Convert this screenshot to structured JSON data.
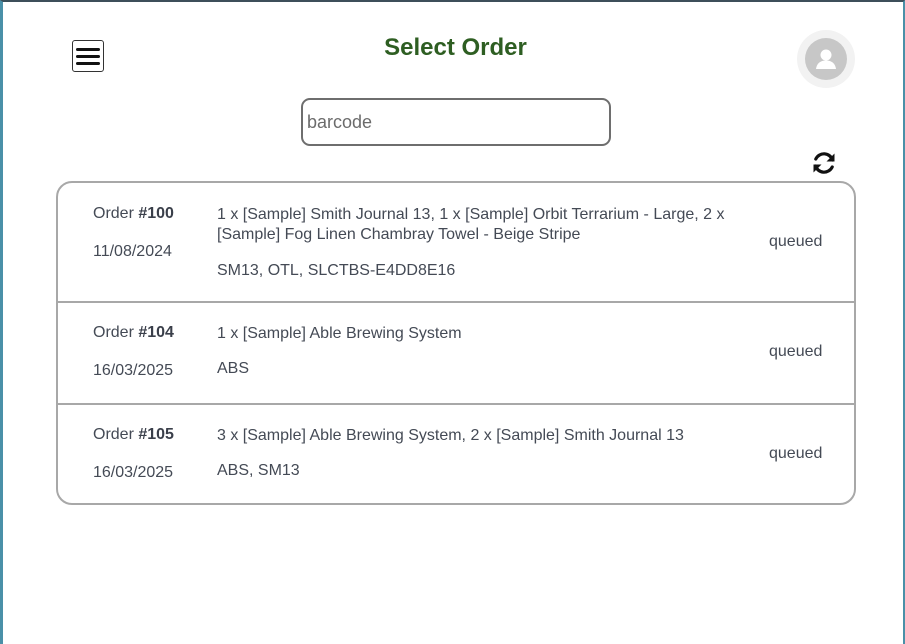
{
  "header": {
    "title": "Select Order",
    "menu_icon": "hamburger-icon",
    "avatar_icon": "user-icon"
  },
  "search": {
    "placeholder": "barcode",
    "value": ""
  },
  "toolbar": {
    "refresh_icon": "refresh-icon"
  },
  "orders": [
    {
      "label": "Order ",
      "number": "#100",
      "date": "11/08/2024",
      "items": "1 x [Sample] Smith Journal 13, 1 x [Sample] Orbit Terrarium - Large, 2 x [Sample] Fog Linen Chambray Towel - Beige Stripe",
      "skus": "SM13, OTL, SLCTBS-E4DD8E16",
      "status": "queued"
    },
    {
      "label": "Order ",
      "number": "#104",
      "date": "16/03/2025",
      "items": "1 x [Sample] Able Brewing System",
      "skus": "ABS",
      "status": "queued"
    },
    {
      "label": "Order ",
      "number": "#105",
      "date": "16/03/2025",
      "items": "3 x [Sample] Able Brewing System, 2 x [Sample] Smith Journal 13",
      "skus": "ABS, SM13",
      "status": "queued"
    }
  ],
  "colors": {
    "title": "#2e5e22",
    "border": "#a8a8a8",
    "text": "#444a55"
  }
}
